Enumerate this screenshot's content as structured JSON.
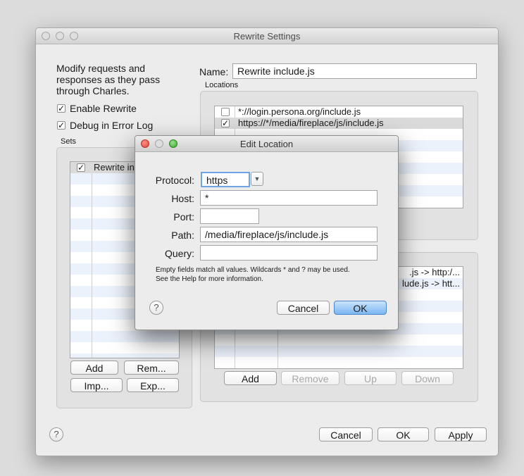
{
  "window": {
    "title": "Rewrite Settings"
  },
  "left": {
    "description": [
      "Modify requests and",
      "responses as they pass",
      "through Charles."
    ],
    "enable_rewrite": {
      "label": "Enable Rewrite",
      "checked": true
    },
    "debug_log": {
      "label": "Debug in Error Log",
      "checked": true
    },
    "sets_label": "Sets",
    "sets": [
      {
        "label": "Rewrite include.js",
        "checked": true
      }
    ],
    "add_button": "Add",
    "remove_button": "Rem...",
    "import_button": "Imp...",
    "export_button": "Exp..."
  },
  "right": {
    "name_label": "Name:",
    "name_value": "Rewrite include.js",
    "locations_label": "Locations",
    "locations": [
      {
        "checked": false,
        "location": "*://login.persona.org/include.js"
      },
      {
        "checked": true,
        "location": "https://*/media/fireplace/js/include.js"
      }
    ],
    "rules": [
      ".js -> http:/...",
      "lude.js -> htt..."
    ],
    "add_button": "Add",
    "remove_button": "Remove",
    "up_button": "Up",
    "down_button": "Down"
  },
  "footer": {
    "help": "?",
    "cancel": "Cancel",
    "ok": "OK",
    "apply": "Apply"
  },
  "dialog": {
    "title": "Edit Location",
    "protocol_label": "Protocol:",
    "protocol_value": "https",
    "host_label": "Host:",
    "host_value": "*",
    "port_label": "Port:",
    "port_value": "",
    "path_label": "Path:",
    "path_value": "/media/fireplace/js/include.js",
    "query_label": "Query:",
    "query_value": "",
    "note_line1": "Empty fields match all values. Wildcards * and ? may be used.",
    "note_line2": "See the Help for more information.",
    "help": "?",
    "cancel": "Cancel",
    "ok": "OK"
  },
  "colors": {
    "accent": "#7ab7f2",
    "selection": "#dadada"
  },
  "icons": {
    "check": "checkmark-icon",
    "dropdown": "triangle-down-icon",
    "help": "question-icon"
  }
}
